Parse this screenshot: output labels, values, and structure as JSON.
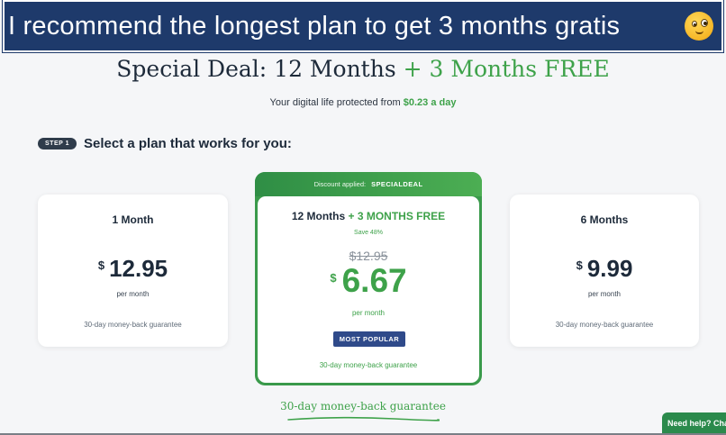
{
  "banner": {
    "text": "I recommend the longest plan to get 3 months gratis",
    "emoji_icon": "winking-face-emoji"
  },
  "headline": {
    "main": "Special Deal: 12 Months",
    "highlight": "+ 3 Months FREE"
  },
  "subline": {
    "text": "Your digital life protected from",
    "price": "$0.23 a day"
  },
  "step": {
    "pill": "STEP 1",
    "title": "Select a plan that works for you:"
  },
  "plans": [
    {
      "name": "1 Month",
      "currency": "$",
      "amount": "12.95",
      "per": "per month",
      "guarantee": "30-day money-back guarantee"
    },
    {
      "discount_label": "Discount applied:",
      "discount_code": "SPECIALDEAL",
      "name": "12 Months",
      "bonus": "+ 3 MONTHS FREE",
      "save": "Save 48%",
      "old_price": "$12.95",
      "currency": "$",
      "amount": "6.67",
      "per": "per month",
      "badge": "MOST POPULAR",
      "guarantee": "30-day money-back guarantee"
    },
    {
      "name": "6 Months",
      "currency": "$",
      "amount": "9.99",
      "per": "per month",
      "guarantee": "30-day money-back guarantee"
    }
  ],
  "bottom_guarantee": "30-day money-back guarantee",
  "help_button": "Need help? Cha",
  "colors": {
    "accent_green": "#3ea24a",
    "banner_blue": "#1e3a6b",
    "badge_blue": "#2f4a8a"
  }
}
